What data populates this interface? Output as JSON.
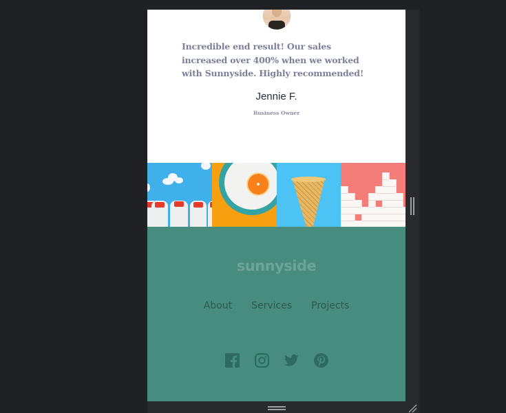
{
  "testimonial": {
    "avatar_alt": "Jennie F. portrait",
    "quote": "Incredible end result! Our sales increased over 400% when we worked with Sunnyside. Highly recommended!",
    "name": "Jennie F.",
    "role": "Business Owner"
  },
  "gallery": {
    "tiles": [
      {
        "name": "milk-bottles",
        "label": "Milk bottles"
      },
      {
        "name": "orange",
        "label": "Orange on plate"
      },
      {
        "name": "cone",
        "label": "Ice cream cone"
      },
      {
        "name": "sugar-cubes",
        "label": "Sugar cubes"
      }
    ]
  },
  "footer": {
    "logo": "sunnyside",
    "nav": [
      {
        "label": "About"
      },
      {
        "label": "Services"
      },
      {
        "label": "Projects"
      }
    ],
    "social": [
      {
        "icon": "facebook-icon"
      },
      {
        "icon": "instagram-icon"
      },
      {
        "icon": "twitter-icon"
      },
      {
        "icon": "pinterest-icon"
      }
    ]
  },
  "colors": {
    "footer_bg": "#478c7d",
    "footer_text": "#2c5a4f",
    "logo": "#6ba597",
    "quote": "#7b7f99",
    "name": "#23303e",
    "chrome_bg": "#292a2d",
    "page_bg": "#202124"
  }
}
